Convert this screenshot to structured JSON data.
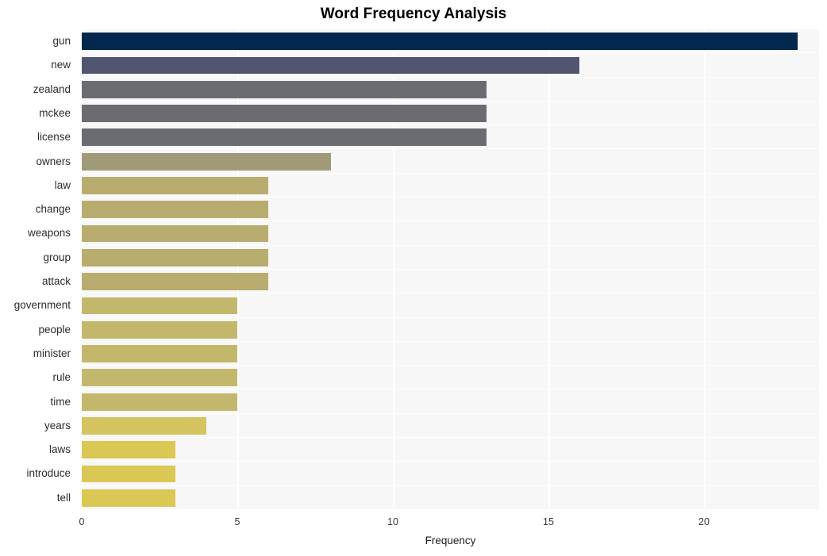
{
  "chart_data": {
    "type": "bar",
    "orientation": "horizontal",
    "title": "Word Frequency Analysis",
    "xlabel": "Frequency",
    "ylabel": "",
    "xlim": [
      0,
      23.7
    ],
    "ylim": [
      0,
      20
    ],
    "xticks": [
      0,
      5,
      10,
      15,
      20
    ],
    "xtick_labels": [
      "0",
      "5",
      "10",
      "15",
      "20"
    ],
    "grid": "vertical-only",
    "legend": "none",
    "categories": [
      "gun",
      "new",
      "zealand",
      "mckee",
      "license",
      "owners",
      "law",
      "change",
      "weapons",
      "group",
      "attack",
      "government",
      "people",
      "minister",
      "rule",
      "time",
      "years",
      "laws",
      "introduce",
      "tell"
    ],
    "values": [
      23,
      16,
      13,
      13,
      13,
      8,
      6,
      6,
      6,
      6,
      6,
      5,
      5,
      5,
      5,
      5,
      4,
      3,
      3,
      3
    ],
    "bar_colors": [
      "#04274d",
      "#515670",
      "#6b6c72",
      "#6b6c72",
      "#6b6c72",
      "#a09a78",
      "#b8ad6e",
      "#b8ad6e",
      "#b8ad6e",
      "#b8ad6e",
      "#b8ad6e",
      "#c3b76b",
      "#c3b76b",
      "#c3b76b",
      "#c3b76b",
      "#c3b76b",
      "#d3c45f",
      "#dac754",
      "#dac754",
      "#dac754"
    ],
    "plot_background": "#f7f7f8",
    "gridline_color": "#ffffff"
  }
}
